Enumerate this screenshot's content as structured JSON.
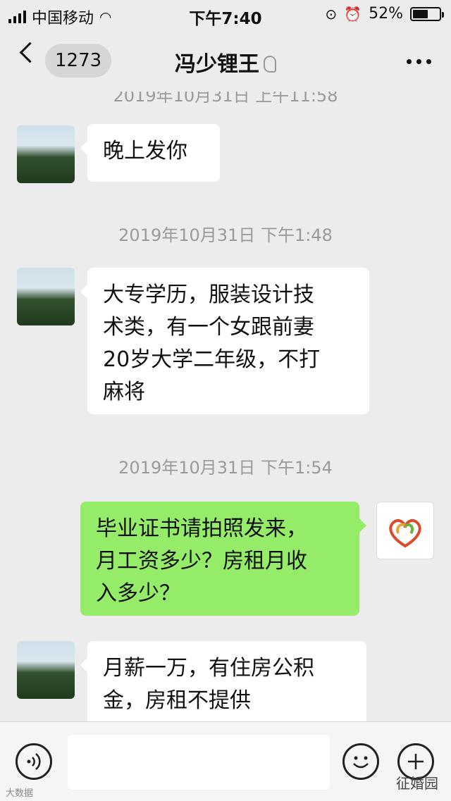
{
  "status_bar": {
    "carrier": "中国移动",
    "time": "下午7:40",
    "battery": "52%"
  },
  "nav": {
    "unread_count": "1273",
    "title": "冯少锂王"
  },
  "chat": {
    "partial_timestamp": "2019年10月31日 上午11:58",
    "messages": [
      {
        "timestamp": "",
        "side": "in",
        "text": "晚上发你"
      },
      {
        "timestamp": "2019年10月31日 下午1:48",
        "side": "in",
        "lines": [
          "大专学历，服装设计技",
          "术类，有一个女跟前妻",
          "20岁大学二年级，不打",
          "麻将"
        ]
      },
      {
        "timestamp": "2019年10月31日 下午1:54",
        "side": "out",
        "lines": [
          "毕业证书请拍照发来，",
          "月工资多少？房租月收",
          "入多少？"
        ]
      },
      {
        "timestamp": "",
        "side": "in",
        "lines": [
          "月薪一万，有住房公积",
          "金，房租不提供"
        ]
      }
    ]
  },
  "input_bar": {
    "placeholder": ""
  },
  "watermarks": {
    "left": "大数据",
    "right": "征婚园"
  },
  "colors": {
    "outgoing_bubble": "#95ec69",
    "incoming_bubble": "#ffffff",
    "background": "#ececec"
  }
}
